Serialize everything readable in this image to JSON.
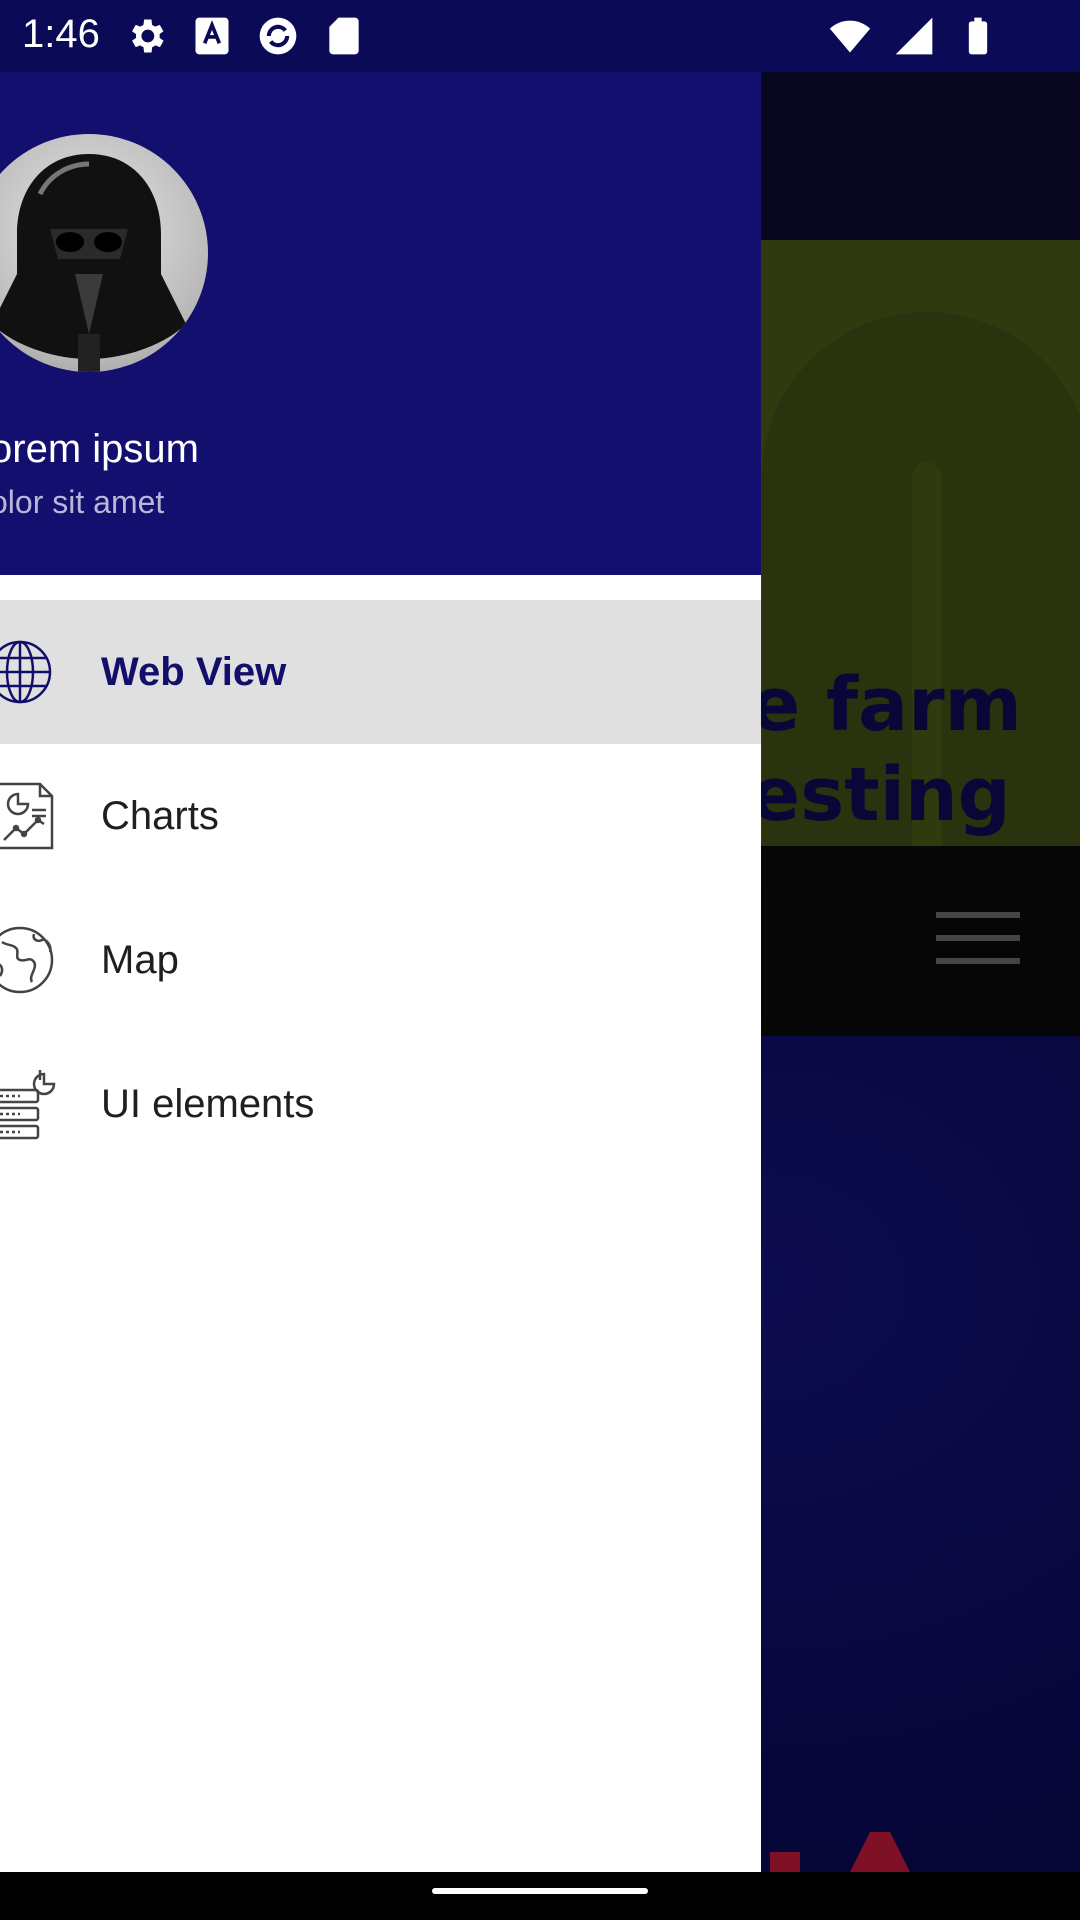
{
  "status_bar": {
    "time": "1:46",
    "left_icons": [
      "settings-icon",
      "font-icon",
      "app-sync-icon",
      "sd-card-icon"
    ],
    "right_icons": [
      "wifi-icon",
      "signal-icon",
      "battery-icon"
    ],
    "background": "#0b0a57"
  },
  "drawer": {
    "header": {
      "name": "orem ipsum",
      "subtitle": "olor sit amet",
      "avatar": "avatar-image",
      "background": "#130f6e"
    },
    "items": [
      {
        "label": "Web View",
        "icon": "globe-icon",
        "selected": true
      },
      {
        "label": "Charts",
        "icon": "chart-document-icon",
        "selected": false
      },
      {
        "label": "Map",
        "icon": "world-map-icon",
        "selected": false
      },
      {
        "label": "UI elements",
        "icon": "ui-elements-icon",
        "selected": false
      }
    ],
    "accent": "#110f6a",
    "selected_background": "#e0e0e0"
  },
  "background_page": {
    "hero_text_line1": "e farm",
    "hero_text_line2": "esting",
    "hero_color": "#4a5a17",
    "menu_icon": "hamburger-menu-icon"
  }
}
